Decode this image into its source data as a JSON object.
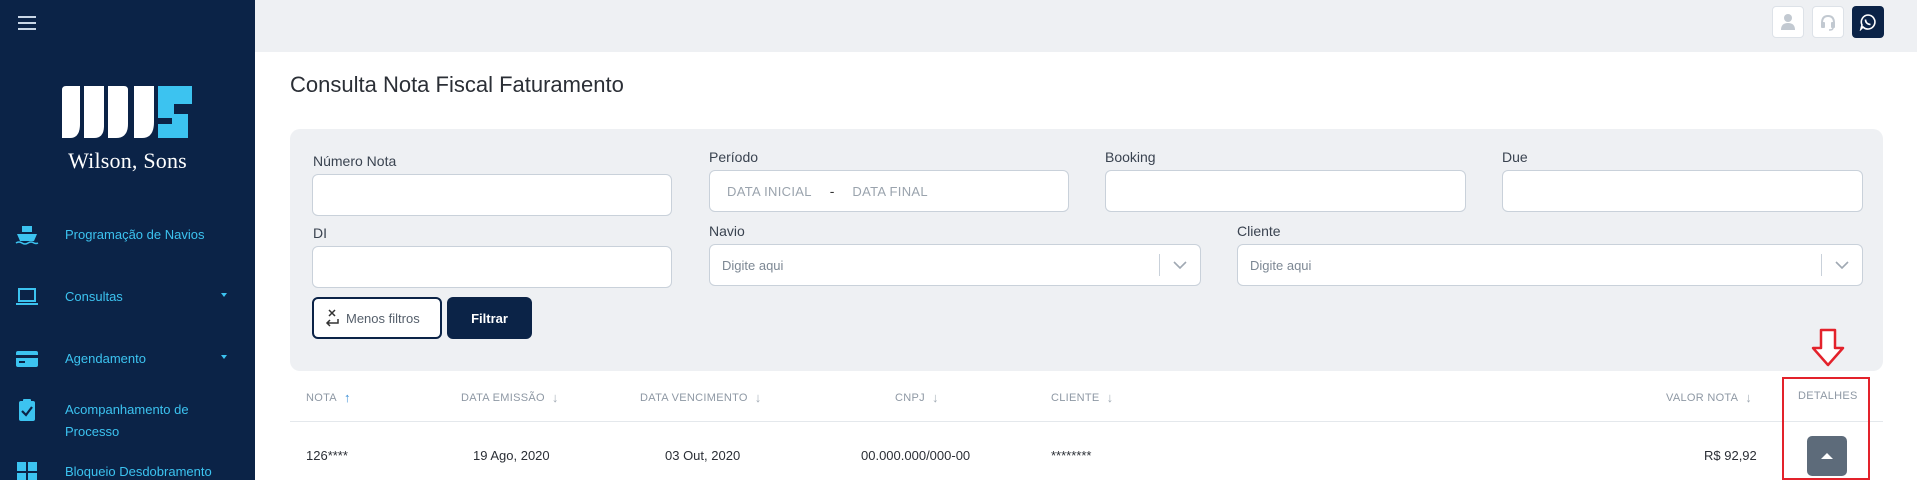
{
  "sidebar": {
    "brand": "Wilson, Sons",
    "items": [
      {
        "label": "Programação de Navios",
        "icon": "ship-icon"
      },
      {
        "label": "Consultas",
        "icon": "laptop-icon",
        "expandable": true
      },
      {
        "label": "Agendamento",
        "icon": "card-icon",
        "expandable": true
      },
      {
        "label": "Acompanhamento de Processo",
        "icon": "clipboard-check-icon"
      },
      {
        "label": "Bloqueio Desdobramento",
        "icon": "grid-icon"
      }
    ]
  },
  "topbar": {
    "buttons": [
      "user-icon",
      "headset-icon",
      "whatsapp-icon"
    ]
  },
  "page": {
    "title": "Consulta Nota Fiscal Faturamento"
  },
  "filters": {
    "numero_nota": {
      "label": "Número Nota",
      "value": "",
      "placeholder": ""
    },
    "periodo": {
      "label": "Período",
      "start_placeholder": "DATA INICIAL",
      "separator": "-",
      "end_placeholder": "DATA FINAL"
    },
    "booking": {
      "label": "Booking",
      "value": "",
      "placeholder": ""
    },
    "due": {
      "label": "Due",
      "value": "",
      "placeholder": ""
    },
    "di": {
      "label": "DI",
      "value": "",
      "placeholder": ""
    },
    "navio": {
      "label": "Navio",
      "placeholder": "Digite aqui"
    },
    "cliente": {
      "label": "Cliente",
      "placeholder": "Digite aqui"
    },
    "less_filters_label": "Menos filtros",
    "filter_label": "Filtrar"
  },
  "table": {
    "columns": [
      {
        "label": "NOTA",
        "sort": "asc"
      },
      {
        "label": "DATA EMISSÃO",
        "sort": "desc"
      },
      {
        "label": "DATA VENCIMENTO",
        "sort": "desc"
      },
      {
        "label": "CNPJ",
        "sort": "desc"
      },
      {
        "label": "CLIENTE",
        "sort": "desc"
      },
      {
        "label": "VALOR NOTA",
        "sort": "desc"
      },
      {
        "label": "DETALHES"
      }
    ],
    "sort_icons": {
      "up": "↑",
      "down": "↓"
    },
    "rows": [
      {
        "nota": "126****",
        "data_emissao": "19 Ago, 2020",
        "data_vencimento": "03 Out, 2020",
        "cnpj": "00.000.000/000-00",
        "cliente": "********",
        "valor_nota": "R$ 92,92"
      }
    ]
  },
  "colors": {
    "sidebar_bg": "#0b2347",
    "nav_text": "#3cc3f0",
    "panel_bg": "#eef0f3",
    "annotation_red": "#e3222b",
    "sort_active": "#3b8fd6"
  }
}
